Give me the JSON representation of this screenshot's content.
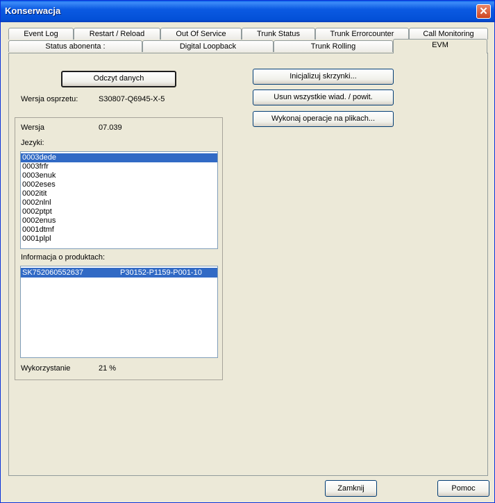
{
  "window": {
    "title": "Konserwacja",
    "close_glyph": "✕"
  },
  "tabs_row1": [
    {
      "label": "Event Log"
    },
    {
      "label": "Restart / Reload"
    },
    {
      "label": "Out Of Service"
    },
    {
      "label": "Trunk Status"
    },
    {
      "label": "Trunk Errorcounter"
    },
    {
      "label": "Call Monitoring"
    }
  ],
  "tabs_row2": [
    {
      "label": "Status abonenta :"
    },
    {
      "label": "Digital Loopback"
    },
    {
      "label": "Trunk Rolling"
    },
    {
      "label": "EVM"
    }
  ],
  "evm": {
    "read_button": "Odczyt danych",
    "hw_version_label": "Wersja osprzetu:",
    "hw_version_value": "S30807-Q6945-X-5",
    "init_button": "Inicjalizuj skrzynki...",
    "delete_button": "Usun wszystkie wiad. / powit.",
    "files_button": "Wykonaj operacje na plikach...",
    "version_label": "Wersja",
    "version_value": "07.039",
    "languages_label": "Jezyki:",
    "languages": [
      "0003dede",
      "0003frfr",
      "0003enuk",
      "0002eses",
      "0002itit",
      "0002nlnl",
      "0002ptpt",
      "0002enus",
      "0001dtmf",
      "0001plpl"
    ],
    "product_info_label": "Informacja o produktach:",
    "products": [
      {
        "serial": "SK752060552637",
        "part": "P30152-P1159-P001-10"
      }
    ],
    "usage_label": "Wykorzystanie",
    "usage_value": "21 %"
  },
  "footer": {
    "close_button": "Zamknij",
    "help_button": "Pomoc"
  }
}
